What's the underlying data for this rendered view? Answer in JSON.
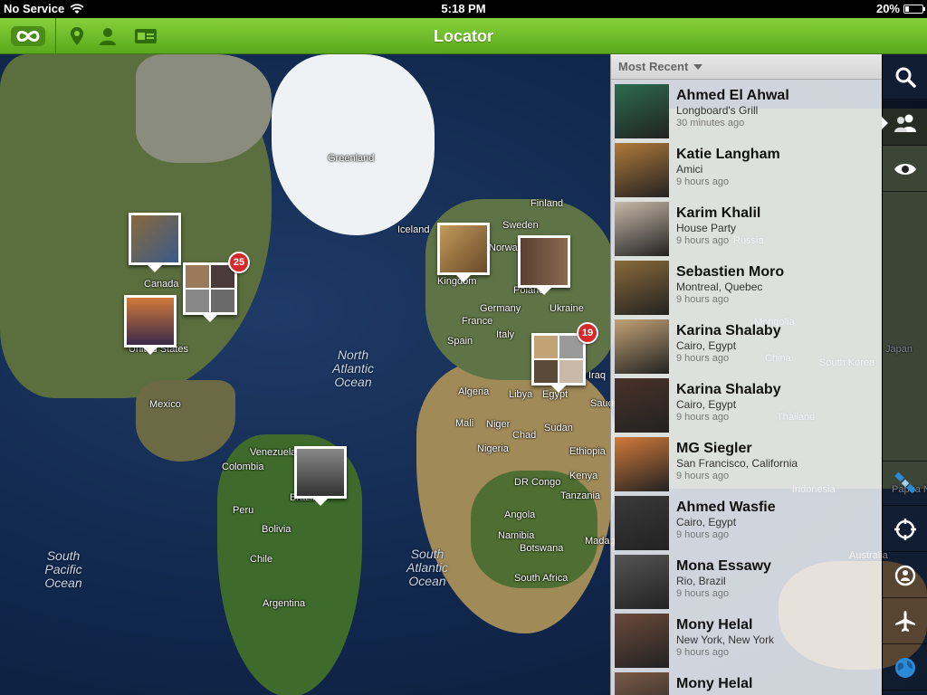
{
  "status_bar": {
    "carrier": "No Service",
    "time": "5:18 PM",
    "battery": "20%",
    "battery_level": 0.2
  },
  "toolbar": {
    "title": "Locator",
    "icons": [
      "infinity-logo-icon",
      "map-pin-icon",
      "person-icon",
      "id-card-icon"
    ]
  },
  "map": {
    "labels": [
      "Greenland",
      "Finland",
      "Iceland",
      "Sweden",
      "Norway",
      "Kingdom",
      "Poland",
      "Germany",
      "Ukraine",
      "France",
      "Spain",
      "Italy",
      "Canada",
      "United States",
      "Mexico",
      "Algeria",
      "Libya",
      "Egypt",
      "Iraq",
      "Saudi Arabia",
      "Mali",
      "Niger",
      "Chad",
      "Sudan",
      "Nigeria",
      "Ethiopia",
      "Kenya",
      "DR Congo",
      "Tanzania",
      "Angola",
      "Namibia",
      "Botswana",
      "South Africa",
      "Venezuela",
      "Colombia",
      "Brazil",
      "Peru",
      "Bolivia",
      "Chile",
      "Argentina",
      "Madagascar",
      "Russia",
      "Mongolia",
      "China",
      "Japan",
      "South Korea",
      "Thailand",
      "Indonesia",
      "Papua New Guinea",
      "Australia"
    ],
    "oceans": [
      "North\nAtlantic\nOcean",
      "South\nAtlantic\nOcean",
      "South\nPacific\nOcean"
    ],
    "clusters": [
      {
        "badge": "25"
      },
      {
        "badge": "19"
      }
    ]
  },
  "panel": {
    "sort_label": "Most Recent",
    "items": [
      {
        "name": "Ahmed El Ahwal",
        "place": "Longboard's Grill",
        "time": "30 minutes ago",
        "color": "#2d6b4f"
      },
      {
        "name": "Katie Langham",
        "place": "Amici",
        "time": "9 hours ago",
        "color": "#b07a3a"
      },
      {
        "name": "Karim Khalil",
        "place": "House Party",
        "time": "9 hours ago",
        "color": "#c9b9a8"
      },
      {
        "name": "Sebastien Moro",
        "place": "Montreal, Quebec",
        "time": "9 hours ago",
        "color": "#8a6a3a"
      },
      {
        "name": "Karina Shalaby",
        "place": "Cairo, Egypt",
        "time": "9 hours ago",
        "color": "#c2a276"
      },
      {
        "name": "Karina Shalaby",
        "place": "Cairo, Egypt",
        "time": "9 hours ago",
        "color": "#4a3228"
      },
      {
        "name": "MG Siegler",
        "place": "San Francisco, California",
        "time": "9 hours ago",
        "color": "#d27a3a"
      },
      {
        "name": "Ahmed Wasfie",
        "place": "Cairo, Egypt",
        "time": "9 hours ago",
        "color": "#3a3a3a"
      },
      {
        "name": "Mona Essawy",
        "place": "Rio, Brazil",
        "time": "9 hours ago",
        "color": "#555555"
      },
      {
        "name": "Mony Helal",
        "place": "New York, New York",
        "time": "9 hours ago",
        "color": "#6b4a3a"
      },
      {
        "name": "Mony Helal",
        "place": "",
        "time": "",
        "color": "#7a5a48"
      }
    ]
  },
  "rail": {
    "buttons": [
      "search-icon",
      "people-icon",
      "eye-icon",
      "satellite-icon",
      "crosshair-icon",
      "person-circle-icon",
      "airplane-icon",
      "globe-icon"
    ]
  },
  "colors": {
    "accent_green": "#6bbf2a",
    "badge_red": "#d42a2a",
    "globe_blue": "#2b8ad6"
  }
}
